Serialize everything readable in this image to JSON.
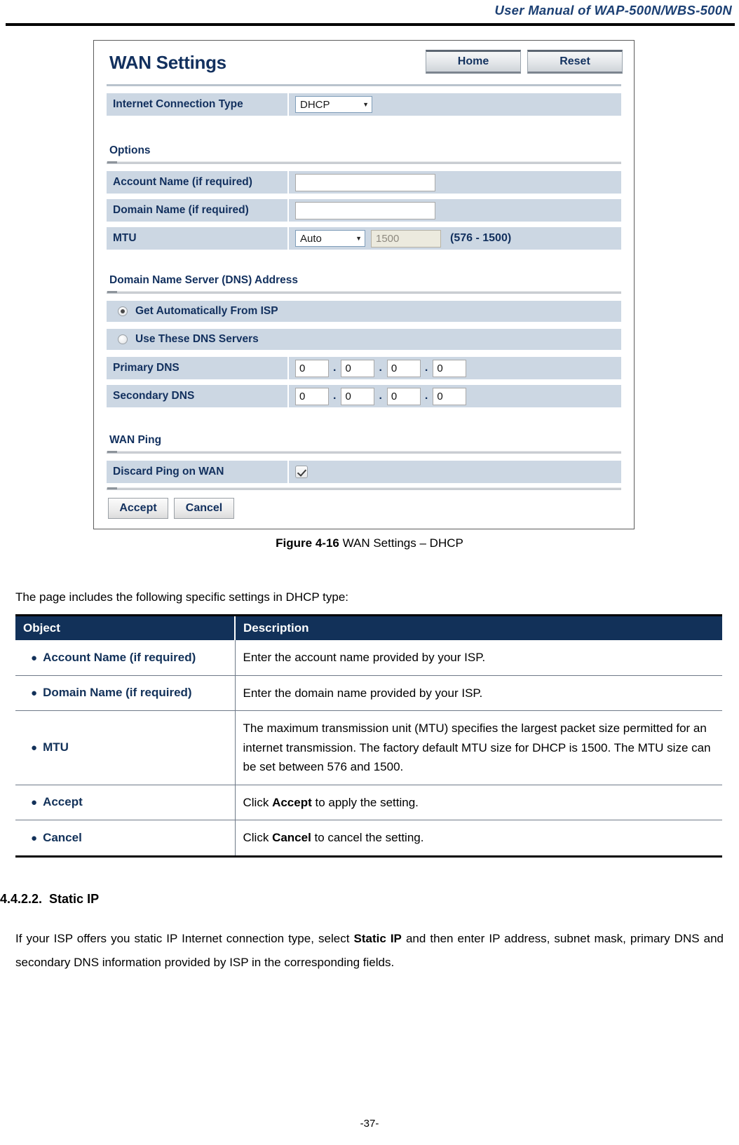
{
  "page": {
    "header_title": "User  Manual  of  WAP-500N/WBS-500N",
    "page_number": "-37-"
  },
  "screenshot": {
    "panel_title": "WAN Settings",
    "top_buttons": [
      {
        "label": "Home",
        "name": "home-button"
      },
      {
        "label": "Reset",
        "name": "reset-button"
      }
    ],
    "connection_type": {
      "label": "Internet Connection Type",
      "value": "DHCP"
    },
    "options": {
      "legend": "Options",
      "account_name": {
        "label": "Account Name (if required)",
        "value": ""
      },
      "domain_name": {
        "label": "Domain Name (if required)",
        "value": ""
      },
      "mtu": {
        "label": "MTU",
        "mode": "Auto",
        "size": "1500",
        "hint": "(576 - 1500)"
      }
    },
    "dns": {
      "legend": "Domain Name Server (DNS) Address",
      "radio_auto": {
        "label": "Get Automatically From ISP",
        "checked": true
      },
      "radio_manual": {
        "label": "Use These DNS Servers",
        "checked": false
      },
      "primary": {
        "label": "Primary DNS",
        "octets": [
          "0",
          "0",
          "0",
          "0"
        ]
      },
      "secondary": {
        "label": "Secondary DNS",
        "octets": [
          "0",
          "0",
          "0",
          "0"
        ]
      }
    },
    "wan_ping": {
      "legend": "WAN Ping",
      "discard": {
        "label": "Discard Ping on WAN",
        "checked": true
      }
    },
    "actions": [
      {
        "label": "Accept",
        "name": "accept-button"
      },
      {
        "label": "Cancel",
        "name": "cancel-button"
      }
    ],
    "colors": {
      "panel_title": "#12305e",
      "row_background": "#ccd7e3",
      "table_header": "#123159"
    }
  },
  "figure": {
    "label": "Figure 4-16",
    "caption": " WAN Settings – DHCP"
  },
  "intro_text": "The page includes the following specific settings in DHCP type:",
  "table": {
    "headers": {
      "object": "Object",
      "description": "Description"
    },
    "rows": [
      {
        "object": "Account Name (if required)",
        "description": "Enter the account name provided by your ISP."
      },
      {
        "object": "Domain Name (if required)",
        "description": "Enter the domain name provided by your ISP."
      },
      {
        "object": "MTU",
        "description": "The maximum transmission unit (MTU) specifies the largest packet size permitted for an internet transmission. The factory default MTU size for DHCP is 1500. The MTU size can be set between 576 and 1500."
      },
      {
        "object": "Accept",
        "description_pre": "Click ",
        "description_bold": "Accept",
        "description_post": " to apply the setting."
      },
      {
        "object": "Cancel",
        "description_pre": "Click ",
        "description_bold": "Cancel",
        "description_post": " to cancel the setting."
      }
    ]
  },
  "section": {
    "number": "4.4.2.2.",
    "title": "Static IP",
    "paragraph_pre": "If your ISP offers you static IP Internet connection type, select ",
    "paragraph_bold": "Static IP",
    "paragraph_post": " and then enter IP address, subnet mask, primary DNS and secondary DNS information provided by ISP in the corresponding fields."
  }
}
